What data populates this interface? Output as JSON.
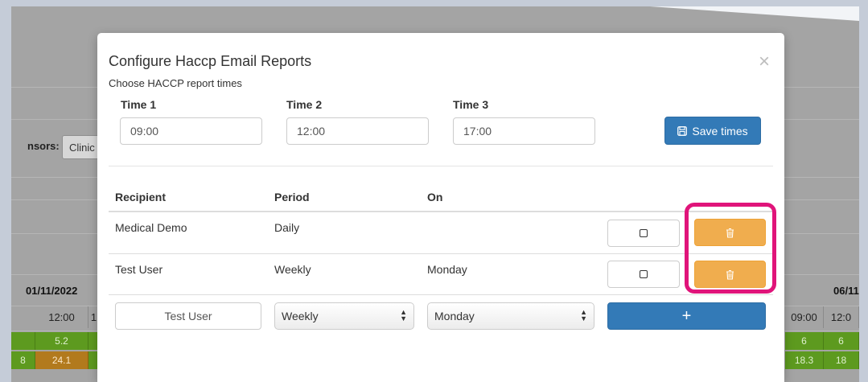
{
  "background": {
    "sensors_label": "nsors:",
    "sensors_select_value": "Clinic",
    "date_left": "01/11/2022",
    "date_right": "06/11/",
    "time_left": "12:00",
    "time_left2": "1",
    "time_right": "09:00",
    "time_right2": "12:0",
    "row1_left": "5.2",
    "row2_left": "24.1",
    "row1_right_a": "6",
    "row1_right_b": "6",
    "row2_right_a": "18.3",
    "row2_right_b": "18",
    "row2_left_edge": "8"
  },
  "modal": {
    "title": "Configure Haccp Email Reports",
    "close": "×",
    "subtitle": "Choose HACCP report times",
    "times": [
      {
        "label": "Time 1",
        "value": "09:00"
      },
      {
        "label": "Time 2",
        "value": "12:00"
      },
      {
        "label": "Time 3",
        "value": "17:00"
      }
    ],
    "save_label": "Save times",
    "table": {
      "headers": [
        "Recipient",
        "Period",
        "On"
      ],
      "rows": [
        {
          "recipient": "Medical Demo",
          "period": "Daily",
          "on": ""
        },
        {
          "recipient": "Test User",
          "period": "Weekly",
          "on": "Monday"
        }
      ]
    },
    "new_entry": {
      "recipient": "Test User",
      "period": "Weekly",
      "on": "Monday",
      "add_label": "+"
    }
  },
  "colors": {
    "primary": "#337ab7",
    "warning": "#f0ad4e",
    "highlight": "#e0147a"
  }
}
